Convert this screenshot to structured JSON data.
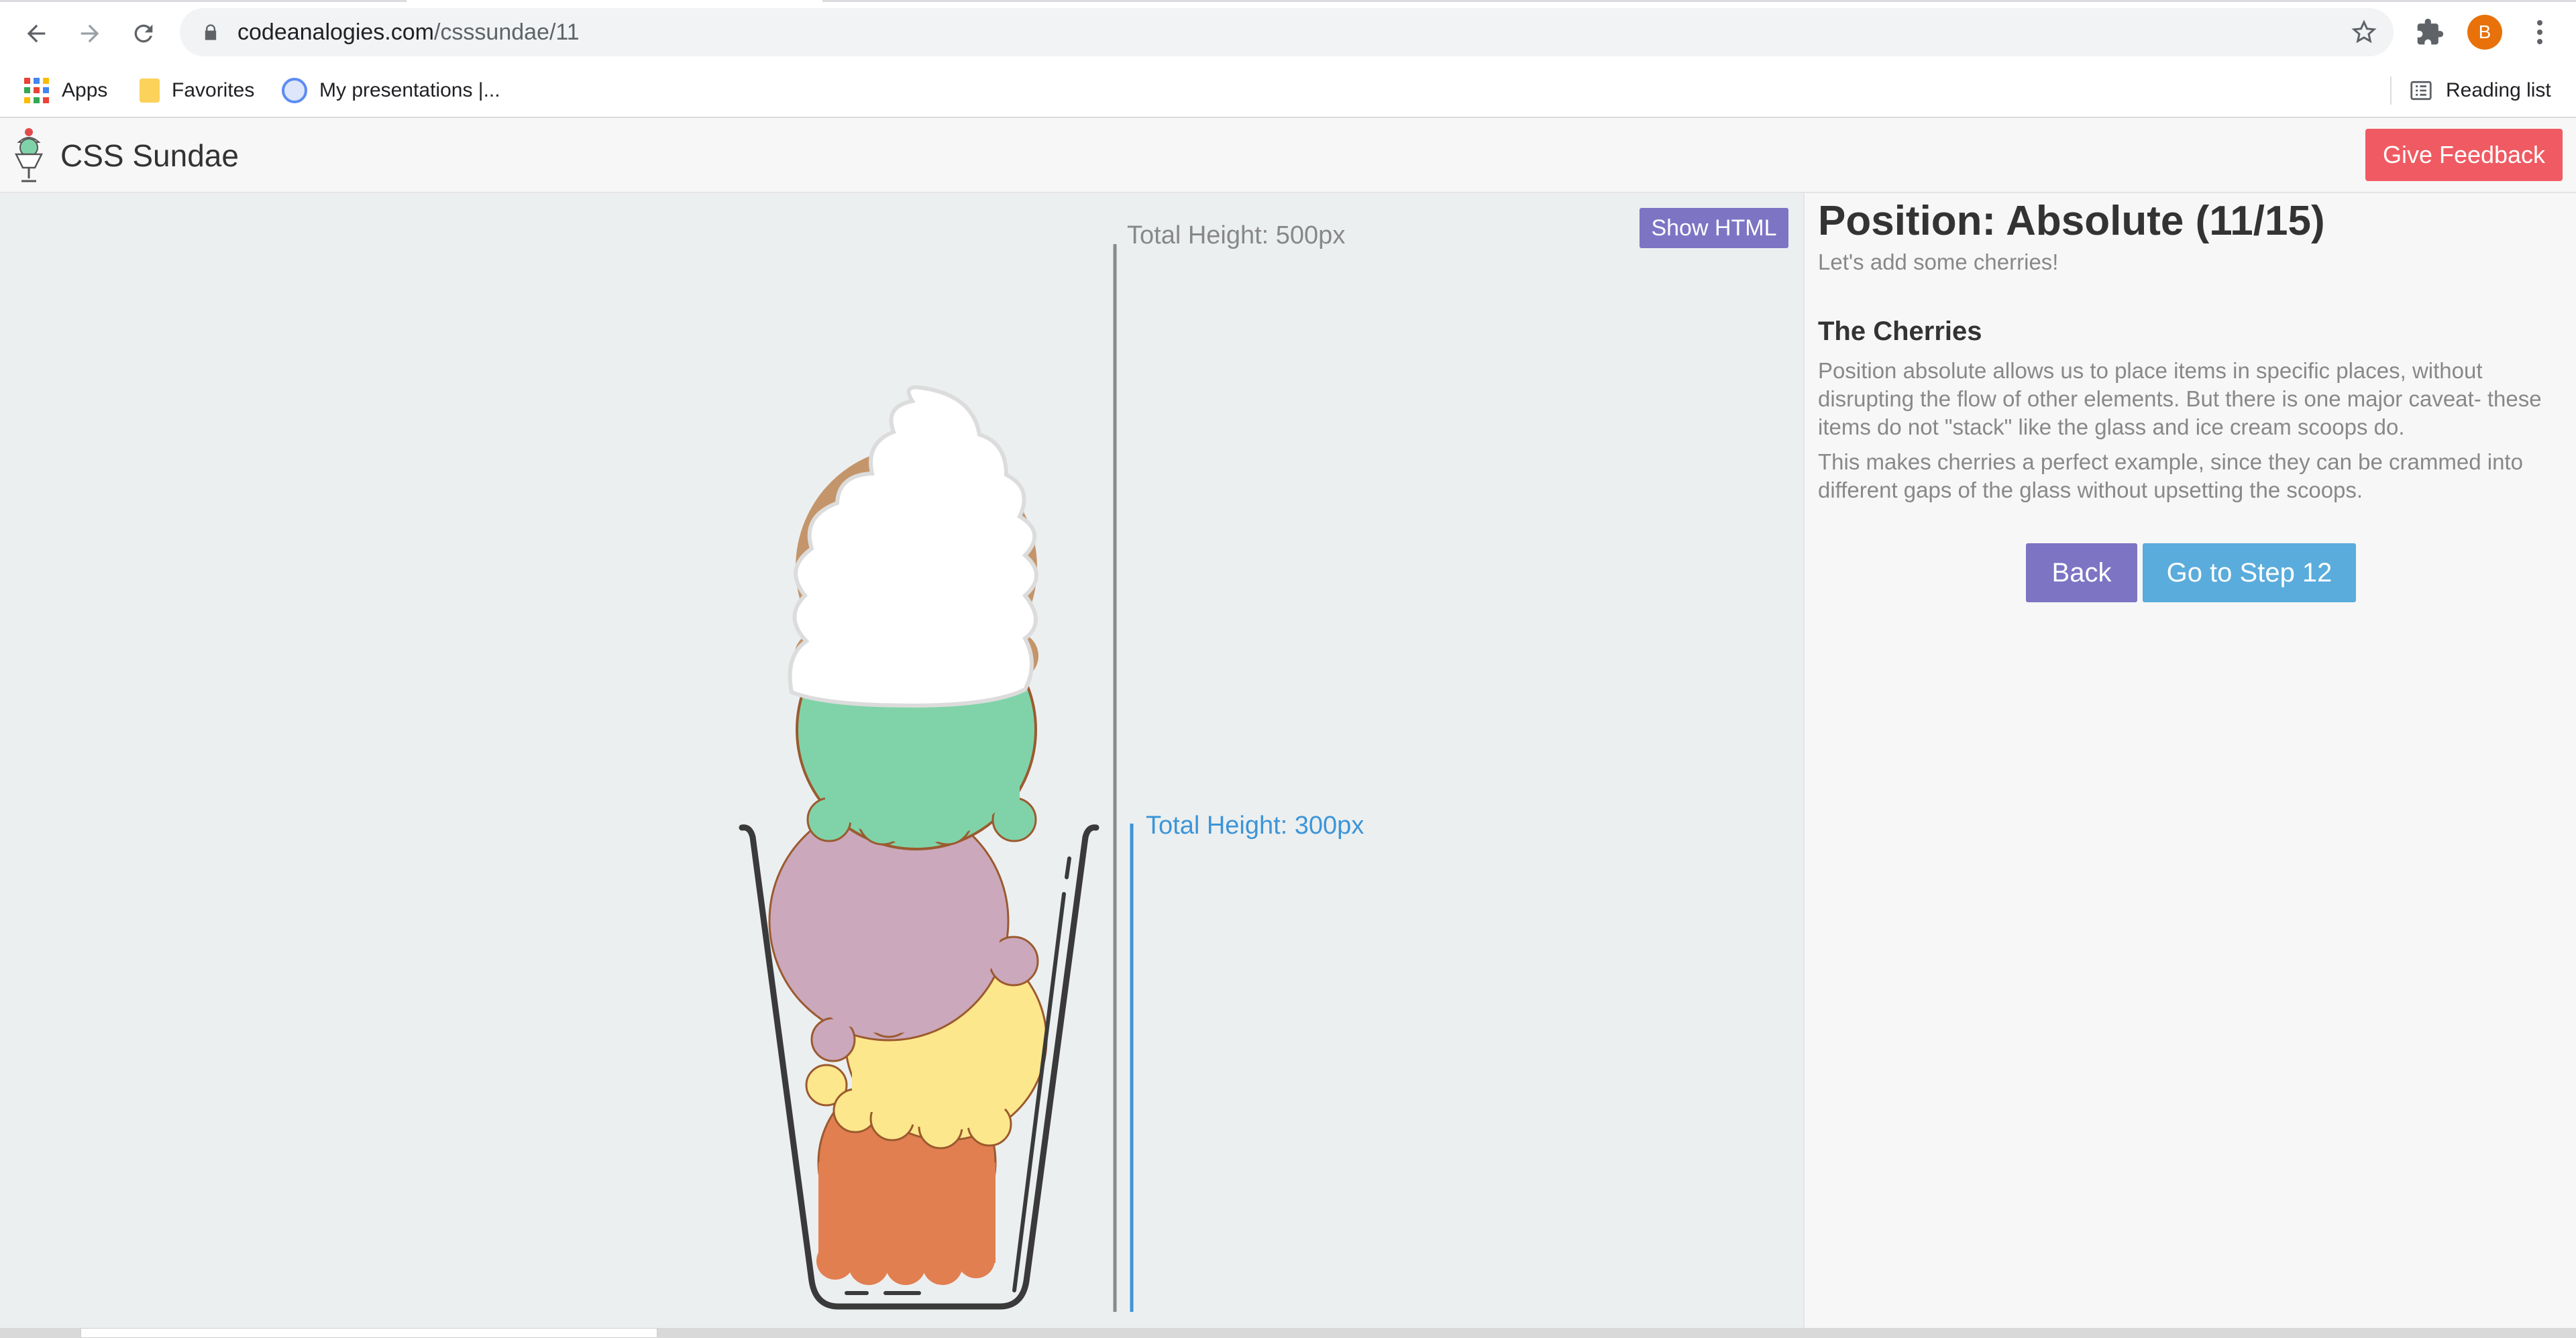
{
  "browser": {
    "url_host": "codeanalogies.com",
    "url_path": "/csssundae/11",
    "avatar_letter": "B",
    "bookmarks": [
      "Apps",
      "Favorites",
      "My presentations |..."
    ],
    "reading_list": "Reading list"
  },
  "header": {
    "title": "CSS Sundae",
    "feedback_label": "Give Feedback"
  },
  "stage": {
    "show_html_label": "Show HTML",
    "total_height_outer": "Total Height: 500px",
    "total_height_glass": "Total Height: 300px",
    "scoop_colors": [
      "#c4956a",
      "#80d3a8",
      "#cba8bb",
      "#fde78c",
      "#e17f50"
    ]
  },
  "lesson": {
    "title": "Position: Absolute (11/15)",
    "subtitle": "Let's add some cherries!",
    "section_heading": "The Cherries",
    "paragraph_1": "Position absolute allows us to place items in specific places, without disrupting the flow of other elements. But there is one major caveat- these items do not \"stack\" like the glass and ice cream scoops do.",
    "paragraph_2": "This makes cherries a perfect example, since they can be crammed into different gaps of the glass without upsetting the scoops.",
    "back_label": "Back",
    "next_label": "Go to Step 12"
  }
}
